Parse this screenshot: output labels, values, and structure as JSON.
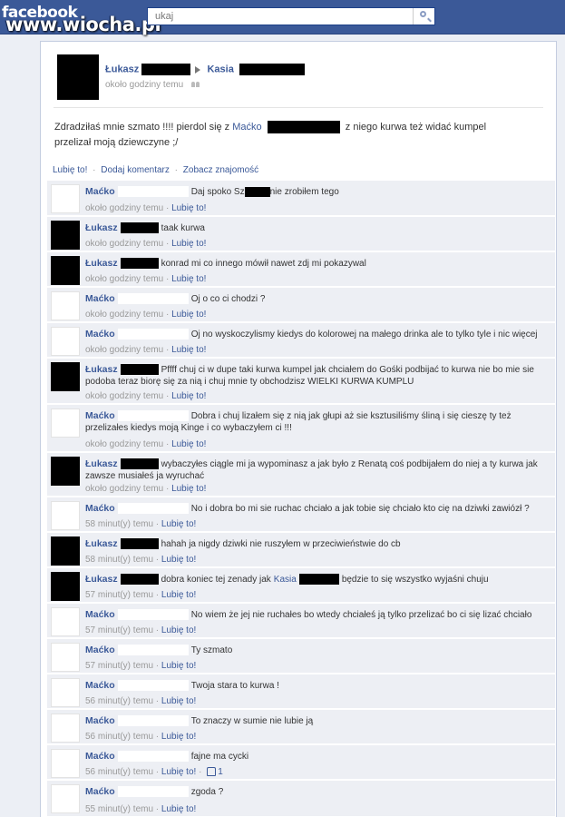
{
  "header": {
    "fb_logo": "facebook",
    "watermark": "www.wiocha.pl",
    "search_value": "ukaj"
  },
  "post": {
    "author": "Łukasz",
    "recipient": "Kasia",
    "time": "około godziny temu",
    "text_before": "Zdradziłaś mnie szmato !!!! pierdol się z",
    "mention": "Maćko",
    "text_after": "z niego kurwa też widać kumpel",
    "text_line2": "przelizał moją dziewczyne ;/"
  },
  "actions": {
    "like": "Lubię to!",
    "comment": "Dodaj komentarz",
    "friendship": "Zobacz znajomość",
    "separator": "·"
  },
  "comments": [
    {
      "author": "Maćko",
      "pre": "Daj spoko Sz",
      "text": "nie zrobiłem tego",
      "time": "około godziny temu",
      "like": "Lubię to!"
    },
    {
      "author": "Łukasz",
      "text": "taak kurwa",
      "time": "około godziny temu",
      "like": "Lubię to!"
    },
    {
      "author": "Łukasz",
      "text": "konrad mi co innego mówił nawet zdj mi pokazywal",
      "time": "około godziny temu",
      "like": "Lubię to!"
    },
    {
      "author": "Maćko",
      "text": "Oj o co ci chodzi ?",
      "time": "około godziny temu",
      "like": "Lubię to!"
    },
    {
      "author": "Maćko",
      "text": "Oj no wyskoczylismy kiedys do kolorowej na małego drinka ale to tylko tyle i nic więcej",
      "time": "około godziny temu",
      "like": "Lubię to!"
    },
    {
      "author": "Łukasz",
      "text": "Pffff chuj ci w dupe taki kurwa kumpel jak chciałem do Gośki podbijać to kurwa nie bo mie sie podoba teraz biorę się za nią i chuj mnie ty obchodzisz WIELKI KURWA KUMPLU",
      "time": "około godziny temu",
      "like": "Lubię to!"
    },
    {
      "author": "Maćko",
      "text": "Dobra i chuj lizałem się z nią jak głupi aż sie ksztusiliśmy śliną i się cieszę ty też przelizałes kiedys moją Kinge i co wybaczyłem ci !!!",
      "time": "około godziny temu",
      "like": "Lubię to!"
    },
    {
      "author": "Łukasz",
      "text": "wybaczyłes ciągle mi ja wypominasz a jak było z Renatą coś podbijałem do niej a ty kurwa jak zawsze musiałeś ja wyruchać",
      "time": "około godziny temu",
      "like": "Lubię to!"
    },
    {
      "author": "Maćko",
      "text": "No i dobra bo mi sie ruchac chciało a jak tobie się chciało kto cię na dziwki zawiózł ?",
      "time": "58 minut(y) temu",
      "like": "Lubię to!"
    },
    {
      "author": "Łukasz",
      "text": "hahah ja nigdy dziwki nie ruszyłem w przeciwieństwie do cb",
      "time": "58 minut(y) temu",
      "like": "Lubię to!"
    },
    {
      "author": "Łukasz",
      "text": "dobra koniec tej zenady jak",
      "mention": "Kasia",
      "after": "będzie to się wszystko wyjaśni chuju",
      "time": "57 minut(y) temu",
      "like": "Lubię to!"
    },
    {
      "author": "Maćko",
      "text": "No wiem że jej nie ruchałes bo wtedy chciałeś ją tylko przelizać bo ci się lizać chciało",
      "time": "57 minut(y) temu",
      "like": "Lubię to!"
    },
    {
      "author": "Maćko",
      "text": "Ty szmato",
      "time": "57 minut(y) temu",
      "like": "Lubię to!"
    },
    {
      "author": "Maćko",
      "text": "Twoja stara to kurwa !",
      "time": "56 minut(y) temu",
      "like": "Lubię to!"
    },
    {
      "author": "Maćko",
      "text": "To znaczy w sumie nie lubie ją",
      "time": "56 minut(y) temu",
      "like": "Lubię to!"
    },
    {
      "author": "Maćko",
      "text": "fajne ma cycki",
      "time": "56 minut(y) temu",
      "like": "Lubię to!",
      "likes_count": "1"
    },
    {
      "author": "Maćko",
      "text": "zgoda ?",
      "time": "55 minut(y) temu",
      "like": "Lubię to!"
    }
  ]
}
